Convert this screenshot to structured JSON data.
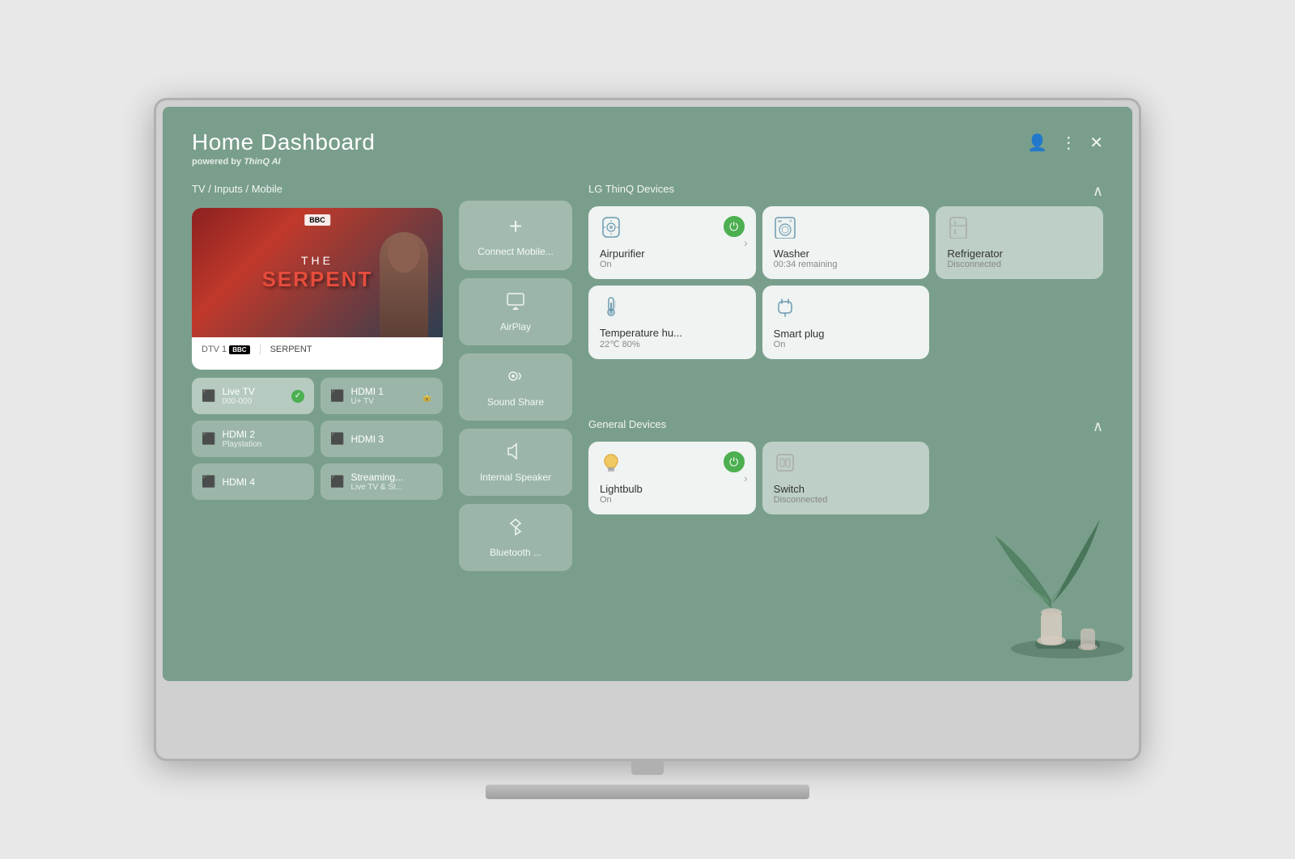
{
  "tv": {
    "bezel_color": "#c8c8c8"
  },
  "dashboard": {
    "title": "Home Dashboard",
    "subtitle_prefix": "powered by ",
    "subtitle_brand": "ThinQ AI",
    "header_controls": {
      "profile_icon": "👤",
      "menu_icon": "⋮",
      "close_icon": "✕"
    }
  },
  "left_section": {
    "label": "TV / Inputs / Mobile",
    "preview": {
      "channel": "DTV 1",
      "bbc_label": "BBC",
      "show_the": "THE",
      "show_name": "SERPENT"
    },
    "inputs": [
      {
        "id": "live-tv",
        "icon": "📺",
        "label": "Live TV",
        "sublabel": "000-000",
        "active": true,
        "check": true
      },
      {
        "id": "hdmi1",
        "icon": "📡",
        "label": "HDMI 1",
        "sublabel": "U+ TV",
        "active": false,
        "lock": true
      },
      {
        "id": "hdmi2",
        "icon": "📡",
        "label": "HDMI 2",
        "sublabel": "Playstation",
        "active": false
      },
      {
        "id": "hdmi3",
        "icon": "📡",
        "label": "HDMI 3",
        "sublabel": "",
        "active": false
      },
      {
        "id": "hdmi4",
        "icon": "📡",
        "label": "HDMI 4",
        "sublabel": "",
        "active": false
      },
      {
        "id": "streaming",
        "icon": "📡",
        "label": "Streaming...",
        "sublabel": "Live TV & St...",
        "active": false
      }
    ]
  },
  "middle_section": {
    "actions": [
      {
        "id": "connect-mobile",
        "icon": "+",
        "label": "Connect Mobile..."
      },
      {
        "id": "airplay",
        "icon": "⊿",
        "label": "AirPlay"
      },
      {
        "id": "sound-share",
        "icon": "🔊",
        "label": "Sound Share"
      },
      {
        "id": "internal-speaker",
        "icon": "🔈",
        "label": "Internal Speaker"
      },
      {
        "id": "bluetooth",
        "icon": "⚡",
        "label": "Bluetooth ..."
      }
    ]
  },
  "thinq_section": {
    "label": "LG ThinQ Devices",
    "devices": [
      {
        "id": "airpurifier",
        "icon": "💨",
        "name": "Airpurifier",
        "status": "On",
        "power": true,
        "disconnected": false,
        "has_chevron": true
      },
      {
        "id": "washer",
        "icon": "🫧",
        "name": "Washer",
        "status": "00:34 remaining",
        "power": false,
        "disconnected": false,
        "has_chevron": false
      },
      {
        "id": "refrigerator",
        "icon": "🧊",
        "name": "Refrigerator",
        "status": "Disconnected",
        "power": false,
        "disconnected": true,
        "has_chevron": false
      },
      {
        "id": "temperature",
        "icon": "🌡️",
        "name": "Temperature hu...",
        "status": "22℃ 80%",
        "power": false,
        "disconnected": false,
        "has_chevron": false
      },
      {
        "id": "smartplug",
        "icon": "🔌",
        "name": "Smart plug",
        "status": "On",
        "power": false,
        "disconnected": false,
        "has_chevron": false
      }
    ]
  },
  "general_section": {
    "label": "General Devices",
    "devices": [
      {
        "id": "lightbulb",
        "icon": "💡",
        "name": "Lightbulb",
        "status": "On",
        "power": true,
        "disconnected": false,
        "has_chevron": true
      },
      {
        "id": "switch",
        "icon": "🔲",
        "name": "Switch",
        "status": "Disconnected",
        "power": false,
        "disconnected": true,
        "has_chevron": false
      }
    ]
  }
}
